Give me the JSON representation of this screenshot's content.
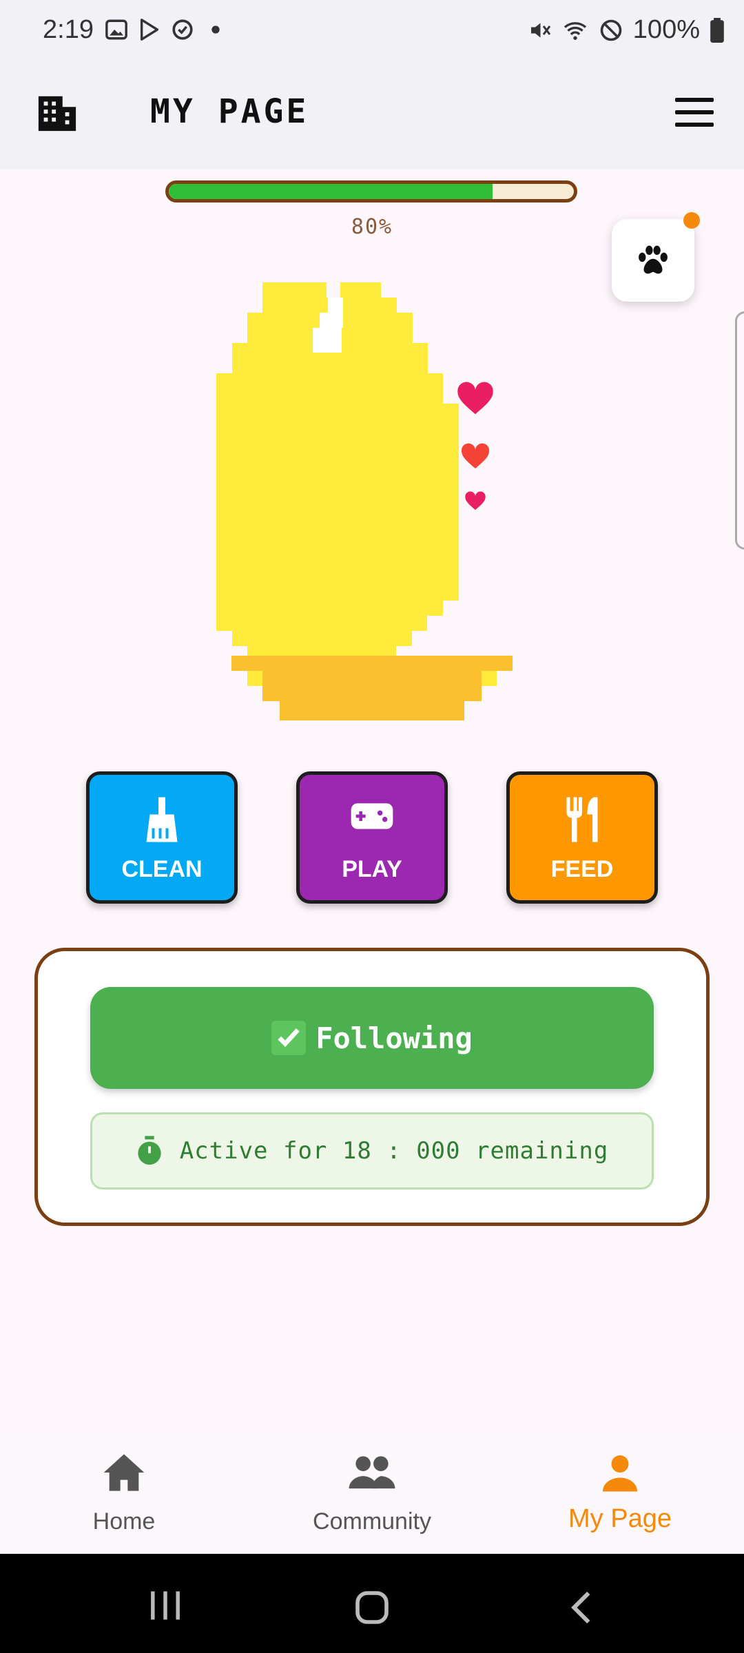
{
  "status_bar": {
    "time": "2:19",
    "battery": "100%"
  },
  "header": {
    "title": "MY PAGE"
  },
  "pet_status": {
    "hp_percent": 80,
    "hp_label": "80%"
  },
  "actions": [
    {
      "label": "CLEAN",
      "icon": "broom-icon",
      "color": "#03a9f4"
    },
    {
      "label": "PLAY",
      "icon": "gamepad-icon",
      "color": "#9c27b0"
    },
    {
      "label": "FEED",
      "icon": "utensils-icon",
      "color": "#ff9800"
    }
  ],
  "follow_card": {
    "button_label": "Following",
    "timer_text": "Active for 18 : 000 remaining"
  },
  "bottom_nav": [
    {
      "label": "Home",
      "icon": "home-icon",
      "active": false
    },
    {
      "label": "Community",
      "icon": "people-icon",
      "active": false
    },
    {
      "label": "My Page",
      "icon": "person-icon",
      "active": true
    }
  ],
  "colors": {
    "accent": "#f5890c",
    "follow_green": "#4caf50",
    "hp_fill": "#2fbe36",
    "card_border": "#7a3f12",
    "pet_body": "#ffeb3b"
  }
}
